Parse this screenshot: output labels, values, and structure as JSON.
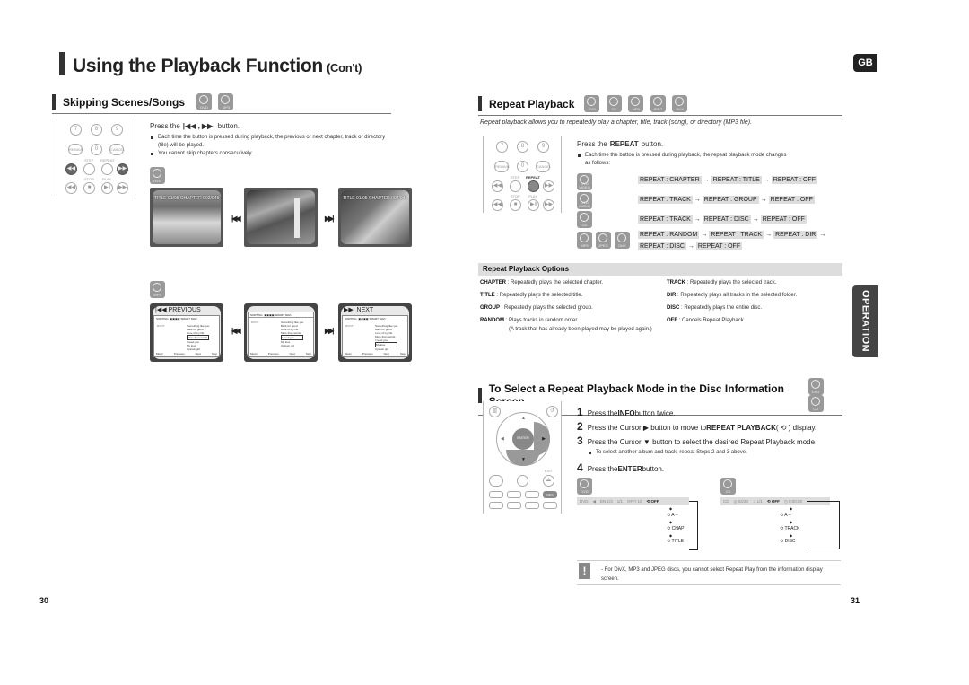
{
  "header": {
    "title": "Using the Playback Function",
    "subtitle": "(Con't)",
    "lang_tab": "GB",
    "side_tab": "OPERATION"
  },
  "skip": {
    "title": "Skipping Scenes/Songs",
    "discs": [
      "DVD",
      "MP3"
    ],
    "instruction_pre": "Press the",
    "instruction_glyphs": "|◀◀ , ▶▶|",
    "instruction_post": "button.",
    "bullets": [
      "Each time the button is pressed during playback, the previous or next chapter, track or directory (file) will be played.",
      "You cannot skip chapters consecutively."
    ],
    "dvd_label": "DVD",
    "mp3_label": "MP3",
    "dvd_screens": [
      {
        "osd": "TITLE 01/05 CHAPTER 002/045"
      },
      {
        "osd": ""
      },
      {
        "osd": "TITLE 01/05 CHAPTER 004/045"
      }
    ],
    "mp3_screens": [
      {
        "heading": "|◀◀ PREVIOUS"
      },
      {
        "heading": ""
      },
      {
        "heading": "▶▶| NEXT"
      }
    ],
    "menu_topbar": "SORTING",
    "menu_mode": "SMART NAVI",
    "menu_root": "ROOT",
    "menu_tracks": [
      "Something like you",
      "Back for good",
      "Love of my life",
      "More than words",
      "I need you",
      "My love",
      "Uptown girl"
    ],
    "menu_footer": [
      "Music",
      "Previous",
      "Next",
      "Stop"
    ],
    "remote_labels": {
      "row1": [
        "7",
        "8",
        "9"
      ],
      "row2": [
        "REMAIN",
        "0",
        "CANCEL"
      ],
      "row3_labels": [
        "STEP",
        "REPEAT"
      ],
      "row4_labels": [
        "STOP",
        "PLAY"
      ]
    }
  },
  "repeat": {
    "title": "Repeat Playback",
    "discs": [
      "DVD",
      "CD",
      "MP3",
      "JPEG",
      "DivX"
    ],
    "intro": "Repeat playback allows you to repeatedly play a chapter, title, track (song), or directory (MP3 file).",
    "instruction_pre": "Press the",
    "instruction_key": "REPEAT",
    "instruction_post": "button.",
    "bullet": "Each time the button is pressed during playback, the repeat playback mode changes as follows:",
    "remote_labels": {
      "step": "STEP",
      "repeat": "REPEAT",
      "stop": "STOP",
      "play": "PLAY"
    },
    "sequences": [
      {
        "discs": [
          "DVD VIDEO"
        ],
        "steps": [
          "REPEAT : CHAPTER",
          "REPEAT : TITLE",
          "REPEAT : OFF"
        ]
      },
      {
        "discs": [
          "DVD AUDIO"
        ],
        "steps": [
          "REPEAT : TRACK",
          "REPEAT : GROUP",
          "REPEAT : OFF"
        ]
      },
      {
        "discs": [
          "CD"
        ],
        "steps": [
          "REPEAT : TRACK",
          "REPEAT : DISC",
          "REPEAT : OFF"
        ]
      },
      {
        "discs": [
          "MP3",
          "JPEG",
          "DivX"
        ],
        "steps": [
          "REPEAT : RANDOM",
          "REPEAT : TRACK",
          "REPEAT : DIR",
          "REPEAT : DISC",
          "REPEAT : OFF"
        ]
      }
    ],
    "arrow": "→"
  },
  "options": {
    "title": "Repeat Playback Options",
    "left": [
      {
        "key": "CHAPTER",
        "desc": " : Repeatedly plays the selected chapter."
      },
      {
        "key": "TITLE",
        "desc": " : Repeatedly plays the selected title."
      },
      {
        "key": "GROUP",
        "desc": " : Repeatedly plays the selected group."
      },
      {
        "key": "RANDOM",
        "desc": " : Plays tracks in random order."
      }
    ],
    "random_note": "(A track that has already been played may be played again.)",
    "right": [
      {
        "key": "TRACK",
        "desc": " : Repeatedly plays the selected track."
      },
      {
        "key": "DIR",
        "desc": " : Repeatedly plays all tracks in the selected folder."
      },
      {
        "key": "DISC",
        "desc": " : Repeatedly plays the entire disc."
      },
      {
        "key": "OFF",
        "desc": " : Cancels Repeat Playback."
      }
    ]
  },
  "select_mode": {
    "title": "To Select a Repeat Playback Mode in the Disc Information Screen",
    "discs": [
      "DVD",
      "CD"
    ],
    "steps": [
      {
        "n": "1",
        "pre": "Press the ",
        "key": "INFO",
        "post": " button twice."
      },
      {
        "n": "2",
        "pre": "Press the Cursor ▶ button to move to ",
        "key": "REPEAT PLAYBACK",
        "post": " ( ⟲ ) display."
      },
      {
        "n": "3",
        "pre": "Press the Cursor ▼ button to select the desired Repeat Playback mode.",
        "key": "",
        "post": ""
      },
      {
        "n": "4",
        "pre": "Press the ",
        "key": "ENTER",
        "post": " button."
      }
    ],
    "step3_bullet": "To select another album and track, repeat Steps 2 and 3 above.",
    "remote": {
      "enter": "ENTER",
      "info": "INFO",
      "exit": "EXIT"
    },
    "dvd_label": "DVD",
    "cd_label": "CD",
    "dvd_osd": [
      "DVD",
      "◀",
      "EN 1/3",
      "1/1",
      "OFF/ 10"
    ],
    "dvd_osd_selected": "⟲ OFF",
    "dvd_modes": [
      "⟲ A –",
      "⟲ CHAP",
      "⟲ TITLE"
    ],
    "cd_osd": [
      "CD",
      "◎ 02/20",
      "♫ L/1"
    ],
    "cd_osd_selected": "⟲ OFF",
    "cd_osd_time": "◷ 0:00:00",
    "cd_modes": [
      "⟲ A –",
      "⟲ TRACK",
      "⟲ DISC"
    ]
  },
  "note": {
    "icon": "!",
    "text": "- For DivX, MP3 and JPEG discs, you cannot select Repeat Play from the information display screen."
  },
  "page_numbers": {
    "left": "30",
    "right": "31"
  }
}
